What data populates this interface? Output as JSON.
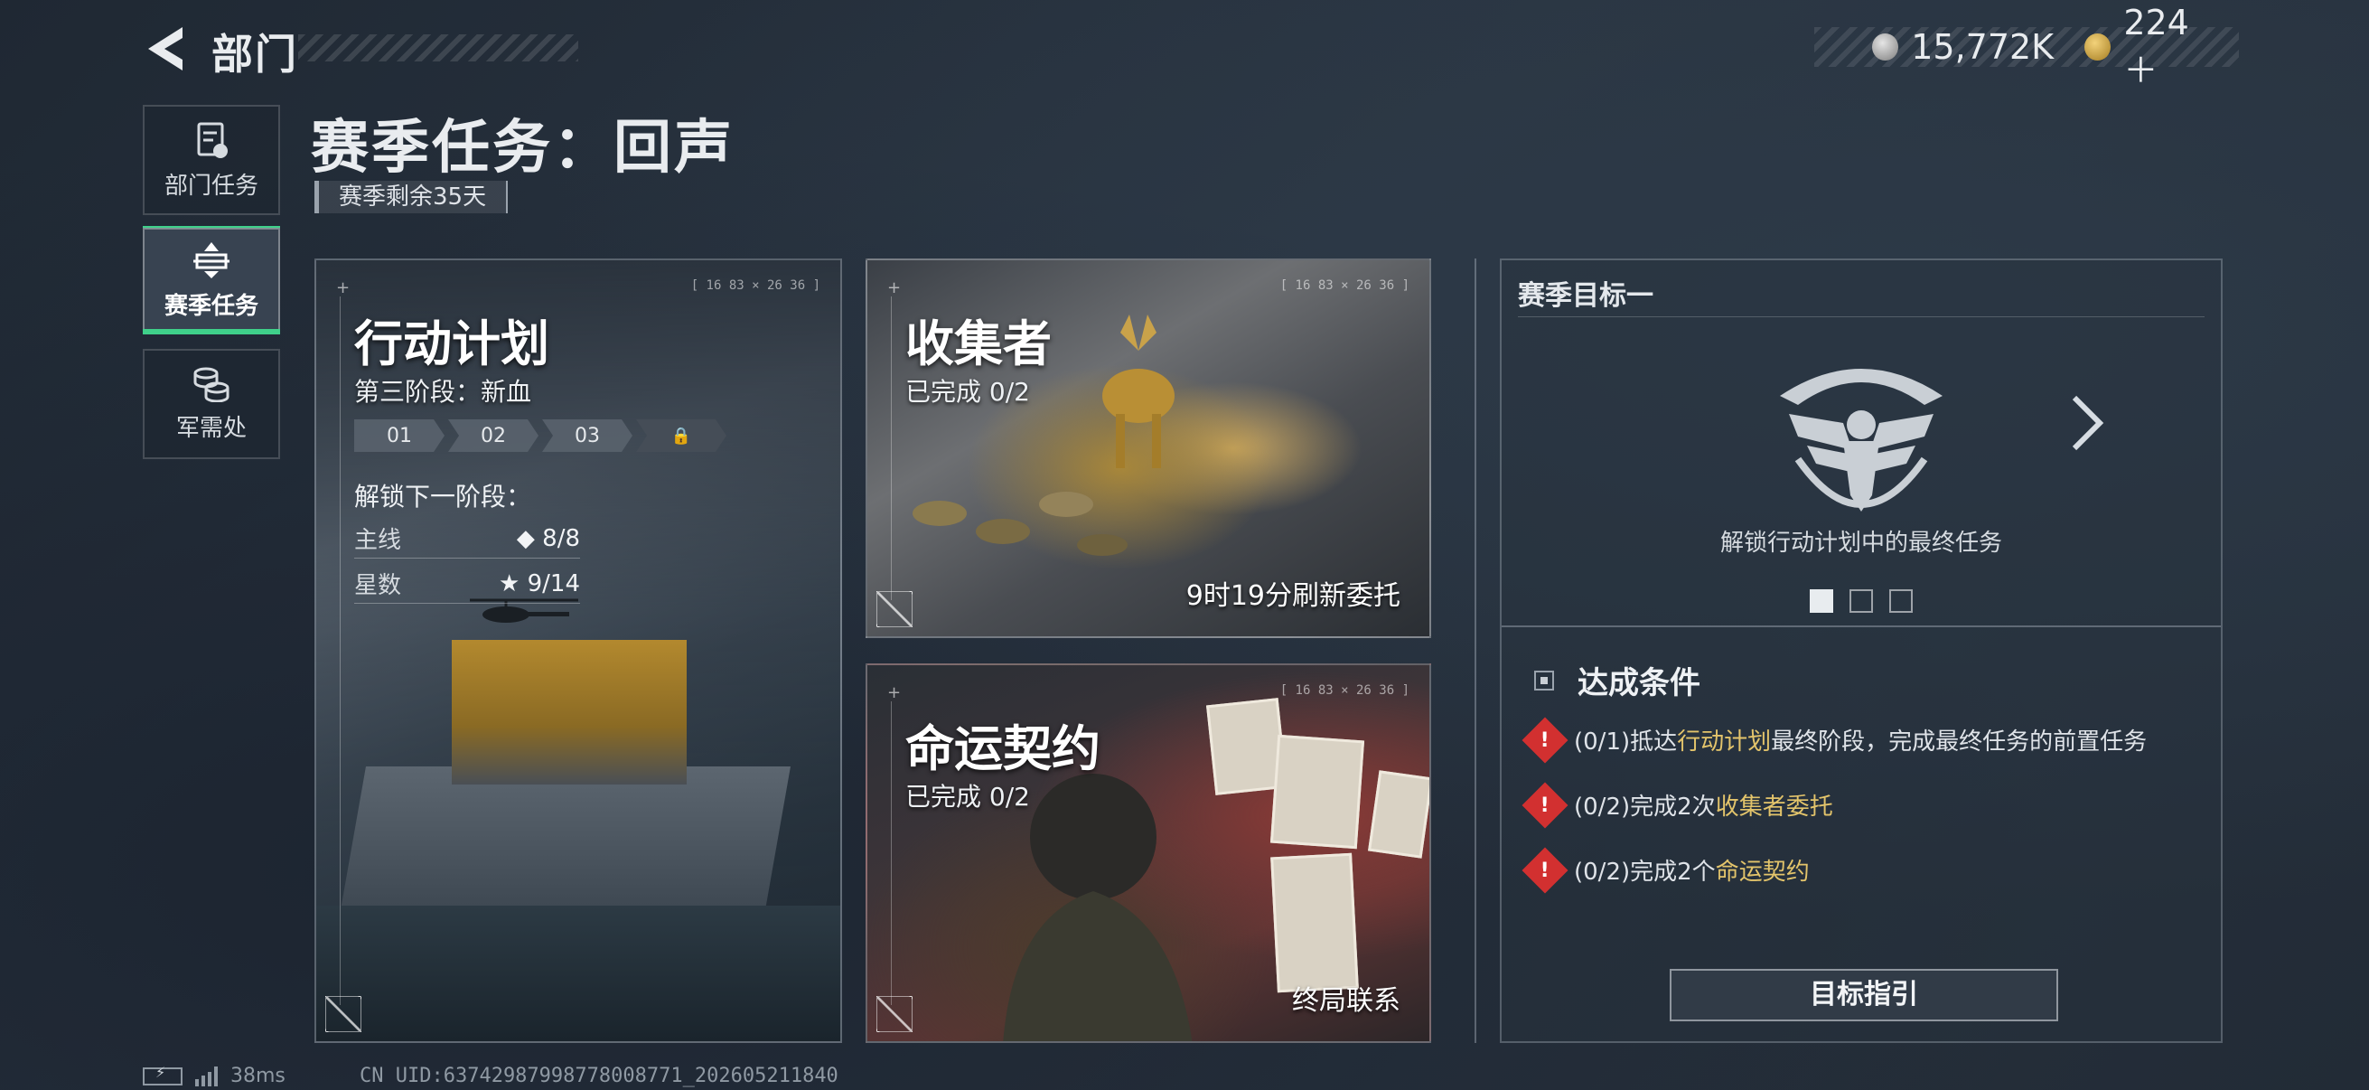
{
  "header": {
    "title": "部门",
    "currency": [
      {
        "icon": "silver-coin-icon",
        "value": "15,772K"
      },
      {
        "icon": "gold-coin-icon",
        "value": "224＋"
      }
    ]
  },
  "sidebar": {
    "items": [
      {
        "label": "部门任务",
        "icon": "clipboard-icon"
      },
      {
        "label": "赛季任务",
        "icon": "season-mission-icon",
        "active": true
      },
      {
        "label": "军需处",
        "icon": "coin-stack-icon"
      }
    ]
  },
  "page": {
    "title": "赛季任务：回声",
    "season_remaining": "赛季剩余35天"
  },
  "cards": {
    "plan": {
      "code": "[ 16 83 × 26 36 ]",
      "title": "行动计划",
      "subtitle": "第三阶段：新血",
      "stages": [
        "01",
        "02",
        "03",
        "🔒"
      ],
      "unlock_title": "解锁下一阶段：",
      "requirements": [
        {
          "label": "主线",
          "value": "◆ 8/8"
        },
        {
          "label": "星数",
          "value": "★ 9/14"
        }
      ]
    },
    "collector": {
      "code": "[ 16 83 × 26 36 ]",
      "title": "收集者",
      "progress": "已完成 0/2",
      "refresh": "9时19分刷新委托"
    },
    "fate": {
      "code": "[ 16 83 × 26 36 ]",
      "title": "命运契约",
      "progress": "已完成 0/2",
      "footer": "终局联系"
    }
  },
  "goal_panel": {
    "title": "赛季目标一",
    "unlock_text": "解锁行动计划中的最终任务",
    "pages_total": 3,
    "active_page": 1,
    "conditions_title": "达成条件",
    "conditions": [
      {
        "prefix": "(0/1)抵达",
        "highlight": "行动计划",
        "suffix": "最终阶段，完成最终任务的前置任务"
      },
      {
        "prefix": "(0/2)完成2次",
        "highlight": "收集者委托",
        "suffix": ""
      },
      {
        "prefix": "(0/2)完成2个",
        "highlight": "命运契约",
        "suffix": ""
      }
    ],
    "guide_button": "目标指引"
  },
  "status_bar": {
    "ping": "38ms",
    "uid": "CN UID:6374298799877800877​1_202605211840"
  },
  "colors": {
    "accent_green": "#3fd08a",
    "highlight_gold": "#e3c46b",
    "warning_red": "#d23030"
  }
}
